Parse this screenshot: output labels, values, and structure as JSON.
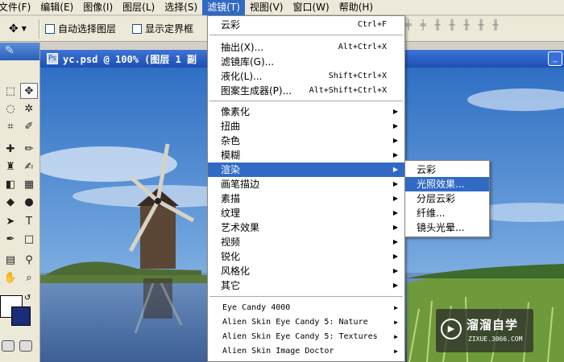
{
  "menubar": {
    "items": [
      {
        "label": "文件(F)"
      },
      {
        "label": "编辑(E)"
      },
      {
        "label": "图像(I)"
      },
      {
        "label": "图层(L)"
      },
      {
        "label": "选择(S)"
      },
      {
        "label": "滤镜(T)",
        "active": true
      },
      {
        "label": "视图(V)"
      },
      {
        "label": "窗口(W)"
      },
      {
        "label": "帮助(H)"
      }
    ]
  },
  "options": {
    "auto_select_label": "自动选择图层",
    "show_bounds_label": "显示定界框"
  },
  "document": {
    "title": "yc.psd @ 100% (图层 1 副"
  },
  "filter_menu": {
    "items": [
      {
        "label": "云彩",
        "shortcut": "Ctrl+F"
      },
      {
        "label": "抽出(X)...",
        "shortcut": "Alt+Ctrl+X"
      },
      {
        "label": "滤镜库(G)..."
      },
      {
        "label": "液化(L)...",
        "shortcut": "Shift+Ctrl+X"
      },
      {
        "label": "图案生成器(P)...",
        "shortcut": "Alt+Shift+Ctrl+X"
      },
      {
        "label": "像素化"
      },
      {
        "label": "扭曲"
      },
      {
        "label": "杂色"
      },
      {
        "label": "模糊"
      },
      {
        "label": "渲染"
      },
      {
        "label": "画笔描边"
      },
      {
        "label": "素描"
      },
      {
        "label": "纹理"
      },
      {
        "label": "艺术效果"
      },
      {
        "label": "视频"
      },
      {
        "label": "锐化"
      },
      {
        "label": "风格化"
      },
      {
        "label": "其它"
      },
      {
        "label": "Eye Candy 4000"
      },
      {
        "label": "Alien Skin Eye Candy 5: Nature"
      },
      {
        "label": "Alien Skin Eye Candy 5: Textures"
      },
      {
        "label": "Alien Skin Image Doctor"
      }
    ]
  },
  "render_submenu": {
    "items": [
      {
        "label": "云彩"
      },
      {
        "label": "光照效果..."
      },
      {
        "label": "分层云彩"
      },
      {
        "label": "纤维..."
      },
      {
        "label": "镜头光晕..."
      }
    ]
  },
  "watermark": {
    "title": "溜溜自学",
    "url": "ZIXUE.3066.COM"
  },
  "colors": {
    "menu_highlight": "#316ac5",
    "titlebar": "#2a5fb7",
    "background_swatch": "#1b2c7a"
  }
}
